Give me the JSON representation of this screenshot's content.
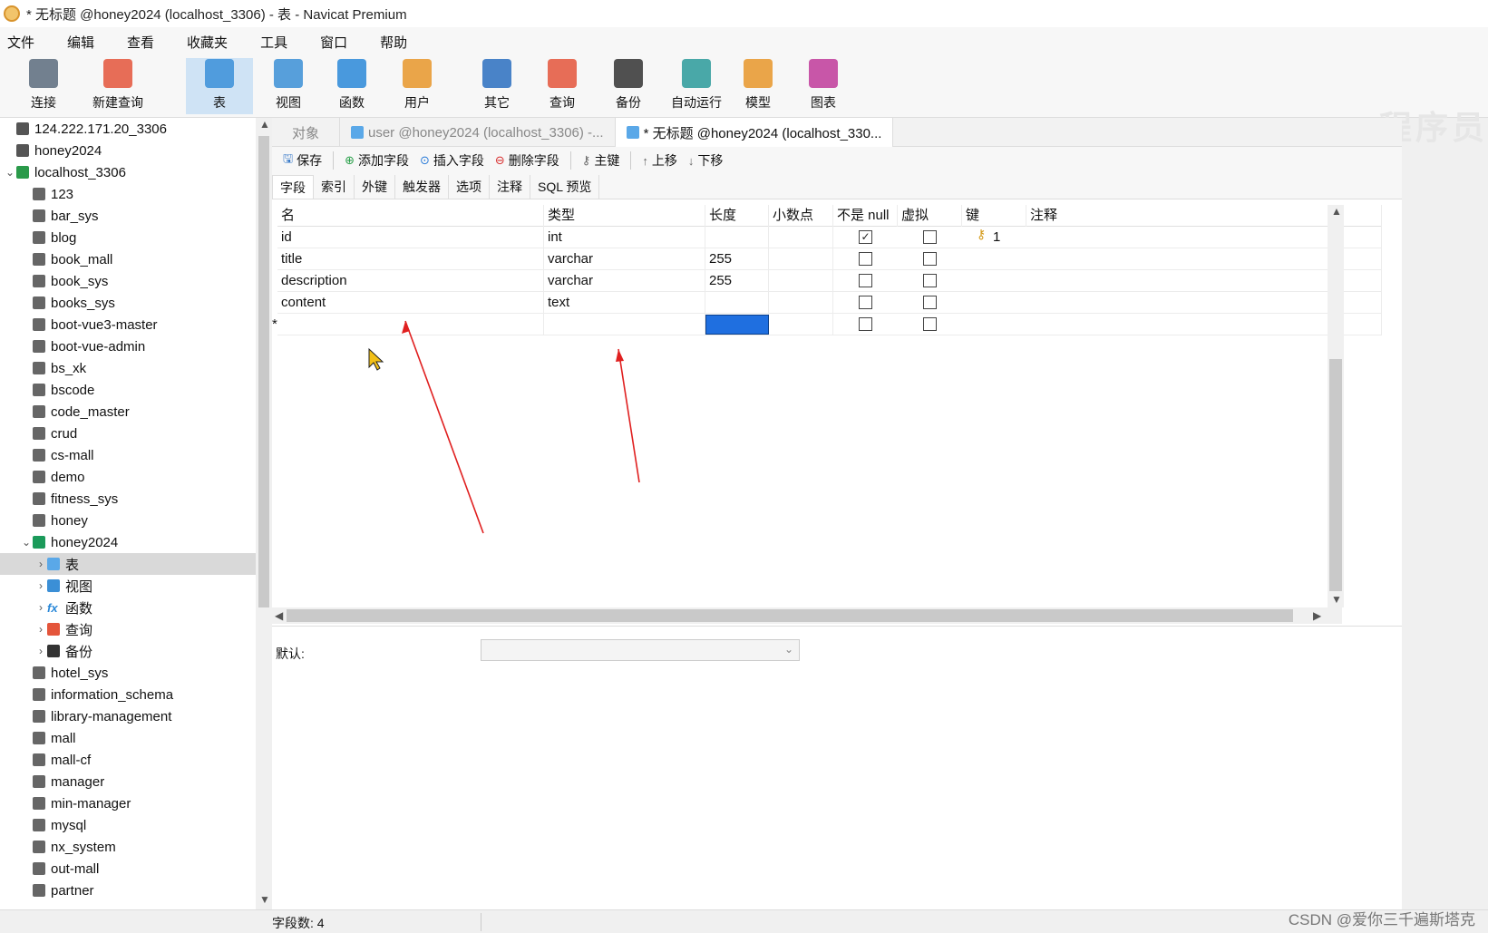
{
  "window": {
    "title": "* 无标题 @honey2024 (localhost_3306) - 表 - Navicat Premium"
  },
  "menu": [
    "文件",
    "编辑",
    "查看",
    "收藏夹",
    "工具",
    "窗口",
    "帮助"
  ],
  "toolbar": [
    {
      "label": "连接",
      "icon": "plug-icon",
      "color": "#5a6b7c"
    },
    {
      "label": "新建查询",
      "icon": "new-query-icon",
      "color": "#e4553b"
    },
    {
      "label": "表",
      "icon": "table-icon",
      "color": "#3a8fd8"
    },
    {
      "label": "视图",
      "icon": "view-icon",
      "color": "#3b8fd6"
    },
    {
      "label": "函数",
      "icon": "function-icon",
      "color": "#2a88d8"
    },
    {
      "label": "用户",
      "icon": "user-icon",
      "color": "#e8962a"
    },
    {
      "label": "其它",
      "icon": "tools-icon",
      "color": "#2a6fc0"
    },
    {
      "label": "查询",
      "icon": "query-icon",
      "color": "#e4553b"
    },
    {
      "label": "备份",
      "icon": "backup-icon",
      "color": "#333333"
    },
    {
      "label": "自动运行",
      "icon": "robot-icon",
      "color": "#2a9a9a"
    },
    {
      "label": "模型",
      "icon": "model-icon",
      "color": "#e8962a"
    },
    {
      "label": "图表",
      "icon": "chart-icon",
      "color": "#c0399a"
    }
  ],
  "watermark": "程序员",
  "tree": [
    {
      "label": "124.222.171.20_3306",
      "type": "conn",
      "level": 0
    },
    {
      "label": "honey2024",
      "type": "conn",
      "level": 0
    },
    {
      "label": "localhost_3306",
      "type": "conn-open",
      "level": 0
    },
    {
      "label": "123",
      "type": "db",
      "level": 1
    },
    {
      "label": "bar_sys",
      "type": "db",
      "level": 1
    },
    {
      "label": "blog",
      "type": "db",
      "level": 1
    },
    {
      "label": "book_mall",
      "type": "db",
      "level": 1
    },
    {
      "label": "book_sys",
      "type": "db",
      "level": 1
    },
    {
      "label": "books_sys",
      "type": "db",
      "level": 1
    },
    {
      "label": "boot-vue3-master",
      "type": "db",
      "level": 1
    },
    {
      "label": "boot-vue-admin",
      "type": "db",
      "level": 1
    },
    {
      "label": "bs_xk",
      "type": "db",
      "level": 1
    },
    {
      "label": "bscode",
      "type": "db",
      "level": 1
    },
    {
      "label": "code_master",
      "type": "db",
      "level": 1
    },
    {
      "label": "crud",
      "type": "db",
      "level": 1
    },
    {
      "label": "cs-mall",
      "type": "db",
      "level": 1
    },
    {
      "label": "demo",
      "type": "db",
      "level": 1
    },
    {
      "label": "fitness_sys",
      "type": "db",
      "level": 1
    },
    {
      "label": "honey",
      "type": "db",
      "level": 1
    },
    {
      "label": "honey2024",
      "type": "db-open",
      "level": 1
    },
    {
      "label": "表",
      "type": "tbl",
      "level": 2,
      "selected": true
    },
    {
      "label": "视图",
      "type": "view",
      "level": 2
    },
    {
      "label": "函数",
      "type": "func",
      "level": 2
    },
    {
      "label": "查询",
      "type": "query",
      "level": 2
    },
    {
      "label": "备份",
      "type": "backup",
      "level": 2
    },
    {
      "label": "hotel_sys",
      "type": "db",
      "level": 1
    },
    {
      "label": "information_schema",
      "type": "db",
      "level": 1
    },
    {
      "label": "library-management",
      "type": "db",
      "level": 1
    },
    {
      "label": "mall",
      "type": "db",
      "level": 1
    },
    {
      "label": "mall-cf",
      "type": "db",
      "level": 1
    },
    {
      "label": "manager",
      "type": "db",
      "level": 1
    },
    {
      "label": "min-manager",
      "type": "db",
      "level": 1
    },
    {
      "label": "mysql",
      "type": "db",
      "level": 1
    },
    {
      "label": "nx_system",
      "type": "db",
      "level": 1
    },
    {
      "label": "out-mall",
      "type": "db",
      "level": 1
    },
    {
      "label": "partner",
      "type": "db",
      "level": 1
    }
  ],
  "tabs": [
    {
      "label": "对象",
      "active": false
    },
    {
      "label": "user @honey2024 (localhost_3306) -...",
      "active": false
    },
    {
      "label": "* 无标题 @honey2024 (localhost_330...",
      "active": true
    }
  ],
  "edit_toolbar": [
    {
      "label": "保存",
      "icon": "save-icon"
    },
    {
      "label": "添加字段",
      "icon": "add-field-icon"
    },
    {
      "label": "插入字段",
      "icon": "insert-field-icon"
    },
    {
      "label": "删除字段",
      "icon": "delete-field-icon"
    },
    {
      "label": "主键",
      "icon": "primary-key-icon"
    },
    {
      "label": "上移",
      "icon": "move-up-icon"
    },
    {
      "label": "下移",
      "icon": "move-down-icon"
    }
  ],
  "subtabs": [
    "字段",
    "索引",
    "外键",
    "触发器",
    "选项",
    "注释",
    "SQL 预览"
  ],
  "grid": {
    "columns": [
      "名",
      "类型",
      "长度",
      "小数点",
      "不是 null",
      "虚拟",
      "键",
      "注释"
    ],
    "rows": [
      {
        "name": "id",
        "type": "int",
        "length": "",
        "decimal": "",
        "not_null": true,
        "virtual": false,
        "key": "1"
      },
      {
        "name": "title",
        "type": "varchar",
        "length": "255",
        "decimal": "",
        "not_null": false,
        "virtual": false,
        "key": ""
      },
      {
        "name": "description",
        "type": "varchar",
        "length": "255",
        "decimal": "",
        "not_null": false,
        "virtual": false,
        "key": ""
      },
      {
        "name": "content",
        "type": "text",
        "length": "",
        "decimal": "",
        "not_null": false,
        "virtual": false,
        "key": ""
      },
      {
        "name": "",
        "type": "",
        "length": "",
        "decimal": "",
        "not_null": false,
        "virtual": false,
        "key": "",
        "new_row_marker": "*"
      }
    ]
  },
  "properties": {
    "default_label": "默认:",
    "default_value": ""
  },
  "status": {
    "field_count": "字段数: 4"
  },
  "csdn_watermark": "CSDN @爱你三千遍斯塔克"
}
